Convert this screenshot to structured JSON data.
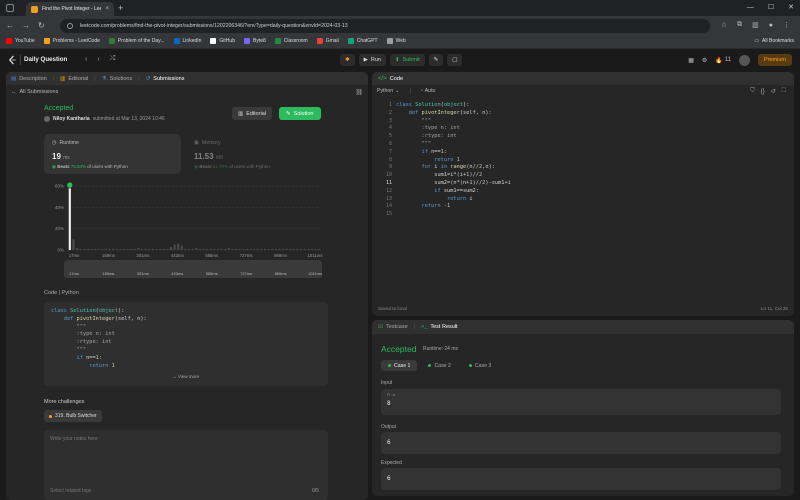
{
  "browser": {
    "tab_title": "Find the Pivot Integer - LeetCo",
    "url": "leetcode.com/problems/find-the-pivot-integer/submissions/1202206346/?envType=daily-question&envId=2024-03-13",
    "bookmarks": [
      "YouTube",
      "Problems - LeetCode",
      "Problem of the Day...",
      "LinkedIn",
      "GitHub",
      "Byte8",
      "Classroom",
      "Gmail",
      "ChatGPT",
      "Web"
    ],
    "bookmark_colors": [
      "#ff0000",
      "#ffa116",
      "#2e7d32",
      "#0a66c2",
      "#ffffff",
      "#7b61ff",
      "#1e8e3e",
      "#ea4335",
      "#10a37f",
      "#9e9e9e"
    ],
    "all_bookmarks": "All Bookmarks"
  },
  "nav": {
    "daily_question": "Daily Question",
    "run": "Run",
    "submit": "Submit",
    "streak": "11",
    "premium": "Premium"
  },
  "left": {
    "tabs": [
      "Description",
      "Editorial",
      "Solutions",
      "Submissions"
    ],
    "all_submissions": "All Submissions",
    "status": "Accepted",
    "user": "Niloy Kantharia",
    "submitted_at": "submitted at Mar 13, 2024 10:46",
    "editorial_btn": "Editorial",
    "solution_btn": "Solution",
    "runtime": {
      "label": "Runtime",
      "value": "19",
      "unit": "ms",
      "beats_prefix": "Beats",
      "beats_pct": "75.83%",
      "beats_suffix": "of users with Python"
    },
    "memory": {
      "label": "Memory",
      "value": "11.53",
      "unit": "MB",
      "beats_prefix": "Beats",
      "beats_pct": "61.79%",
      "beats_suffix": "of users with Python"
    },
    "code_lang": "Code  |  Python",
    "view_more": "View more",
    "more_challenges": "More challenges",
    "challenge": "319. Bulb Switcher",
    "notes_placeholder": "Write your notes here",
    "tags_placeholder": "Select related tags",
    "counter": "0/5"
  },
  "chart_data": {
    "type": "bar",
    "ylim": [
      0,
      60
    ],
    "y_ticks": [
      "60%",
      "40%",
      "20%",
      "0%"
    ],
    "x_ticks": [
      "17ms",
      "159ms",
      "301ms",
      "443ms",
      "585ms",
      "727ms",
      "869ms",
      "1011ms"
    ],
    "range_ticks": [
      "17ms",
      "159ms",
      "301ms",
      "443ms",
      "585ms",
      "727ms",
      "869ms",
      "1011ms"
    ],
    "values": [
      58,
      10,
      2,
      1,
      1,
      1,
      1,
      1,
      1,
      1,
      1,
      1,
      1,
      1,
      1,
      1,
      1,
      1,
      1,
      2,
      1,
      1,
      1,
      1,
      1,
      1,
      1,
      1,
      3,
      5,
      6,
      4,
      1,
      1,
      1,
      2,
      1,
      1,
      1,
      1,
      1,
      1,
      1,
      1,
      2,
      1,
      1,
      1,
      1,
      1,
      1,
      1,
      1,
      1,
      1,
      1,
      1,
      1,
      1,
      1,
      1,
      1,
      1,
      1,
      1,
      1,
      1,
      1,
      1,
      1
    ],
    "highlight_index": 0
  },
  "code": {
    "header": "Code",
    "language": "Python",
    "auto": "Auto",
    "saved": "Saved to local",
    "cursor": "Ln 11, Col 26"
  },
  "result": {
    "tabs": [
      "Testcase",
      "Test Result"
    ],
    "status": "Accepted",
    "runtime": "Runtime: 24 ms",
    "cases": [
      "Case 1",
      "Case 2",
      "Case 3"
    ],
    "input_label": "Input",
    "input_key": "n =",
    "input_value": "8",
    "output_label": "Output",
    "output_value": "6",
    "expected_label": "Expected",
    "expected_value": "6"
  }
}
